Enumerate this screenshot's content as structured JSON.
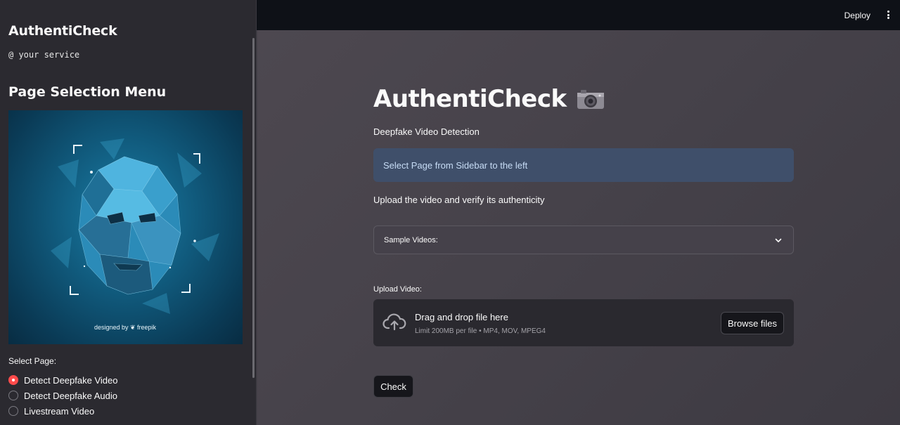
{
  "sidebar": {
    "brand": "AuthentiCheck",
    "tagline": "@ your service",
    "menu_title": "Page Selection Menu",
    "hero_credit": "designed by ❦ freepik",
    "select_label": "Select Page:",
    "radio_options": [
      {
        "label": "Detect Deepfake Video",
        "selected": true
      },
      {
        "label": "Detect Deepfake Audio",
        "selected": false
      },
      {
        "label": "Livestream Video",
        "selected": false
      }
    ]
  },
  "header": {
    "deploy_label": "Deploy",
    "menu_icon": "kebab-menu-icon"
  },
  "main": {
    "title": "AuthentiCheck",
    "title_icon": "camera-icon",
    "subtitle": "Deepfake Video Detection",
    "info": "Select Page from Sidebar to the left",
    "upload_prompt": "Upload the video and verify its authenticity",
    "select": {
      "value": "Sample Videos:",
      "icon": "chevron-down-icon"
    },
    "uploader": {
      "label": "Upload Video:",
      "drop_text": "Drag and drop file here",
      "limit_text": "Limit 200MB per file • MP4, MOV, MPEG4",
      "browse_label": "Browse files",
      "icon": "cloud-upload-icon"
    },
    "check_label": "Check"
  },
  "colors": {
    "accent": "#ff4b4b",
    "info_bg": "#3f4f6a",
    "info_text": "#c7dcf5",
    "header_bg": "#0e1117",
    "sidebar_bg": "#2b2a30"
  }
}
